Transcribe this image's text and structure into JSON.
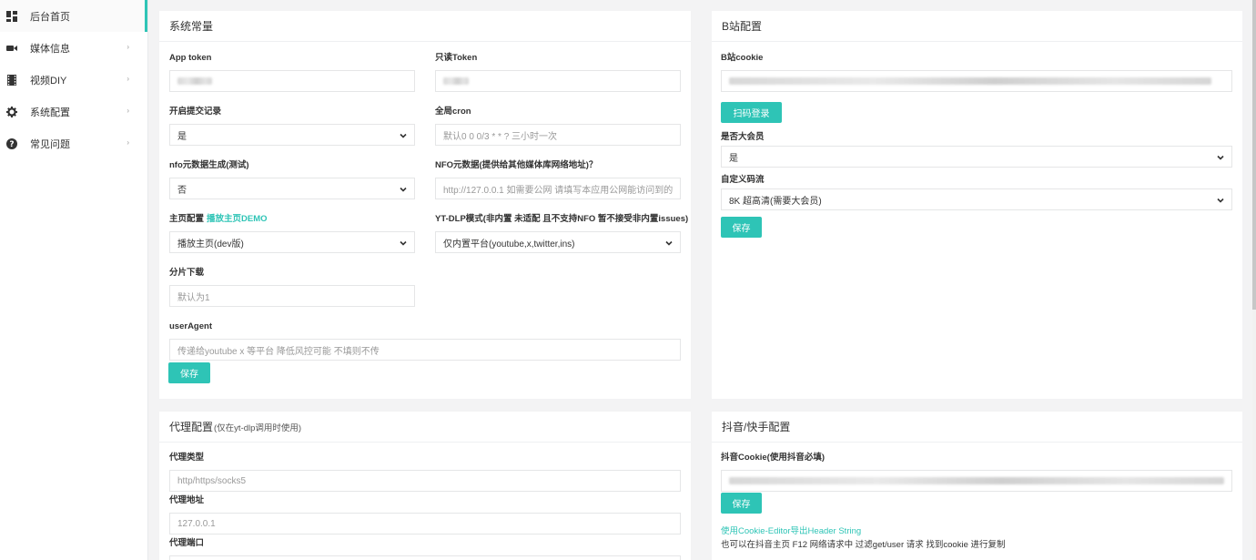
{
  "sidebar": {
    "items": [
      {
        "label": "后台首页",
        "icon": "dashboard-icon"
      },
      {
        "label": "媒体信息",
        "icon": "video-camera-icon"
      },
      {
        "label": "视频DIY",
        "icon": "film-icon"
      },
      {
        "label": "系统配置",
        "icon": "gear-icon"
      },
      {
        "label": "常见问题",
        "icon": "question-circle-icon"
      }
    ]
  },
  "system": {
    "title": "系统常量",
    "app_token_label": "App token",
    "readonly_token_label": "只读Token",
    "submit_log_label": "开启提交记录",
    "submit_log_value": "是",
    "cron_label": "全局cron",
    "cron_placeholder": "默认0 0 0/3 * * ?  三小时一次",
    "nfo_gen_label": "nfo元数据生成(测试)",
    "nfo_gen_value": "否",
    "nfo_addr_label": "NFO元数据(提供给其他媒体库网络地址)？",
    "nfo_addr_placeholder": "http://127.0.0.1 如需要公网 请填写本应用公网能访问到的",
    "home_label": "主页配置",
    "home_link": "播放主页DEMO",
    "home_value": "播放主页(dev版)",
    "ytdlp_label": "YT-DLP模式(非内置 未适配 且不支持NFO 暂不接受非内置issues)",
    "ytdlp_value": "仅内置平台(youtube,x,twitter,ins)",
    "chunk_label": "分片下载",
    "chunk_placeholder": "默认为1",
    "ua_label": "userAgent",
    "ua_placeholder": "传递给youtube  x 等平台 降低风控可能 不填则不传",
    "save": "保存"
  },
  "proxy": {
    "title": "代理配置",
    "title_note": "(仅在yt-dlp调用时使用)",
    "type_label": "代理类型",
    "type_placeholder": "http/https/socks5",
    "addr_label": "代理地址",
    "addr_placeholder": "127.0.0.1",
    "port_label": "代理端口"
  },
  "bili": {
    "title": "B站配置",
    "cookie_label": "B站cookie",
    "scan_login": "扫码登录",
    "vip_label": "是否大会员",
    "vip_value": "是",
    "stream_label": "自定义码流",
    "stream_value": "8K 超高清(需要大会员)",
    "save": "保存"
  },
  "douyin": {
    "title": "抖音/快手配置",
    "cookie_label": "抖音Cookie(使用抖音必填)",
    "save": "保存",
    "tip_link": "使用Cookie-Editor导出Header String",
    "tip_text": "也可以在抖音主页 F12 网络请求中 过滤get/user 请求 找到cookie 进行复制"
  },
  "colors": {
    "accent": "#2ec4b6",
    "background": "#f3f3f4"
  }
}
